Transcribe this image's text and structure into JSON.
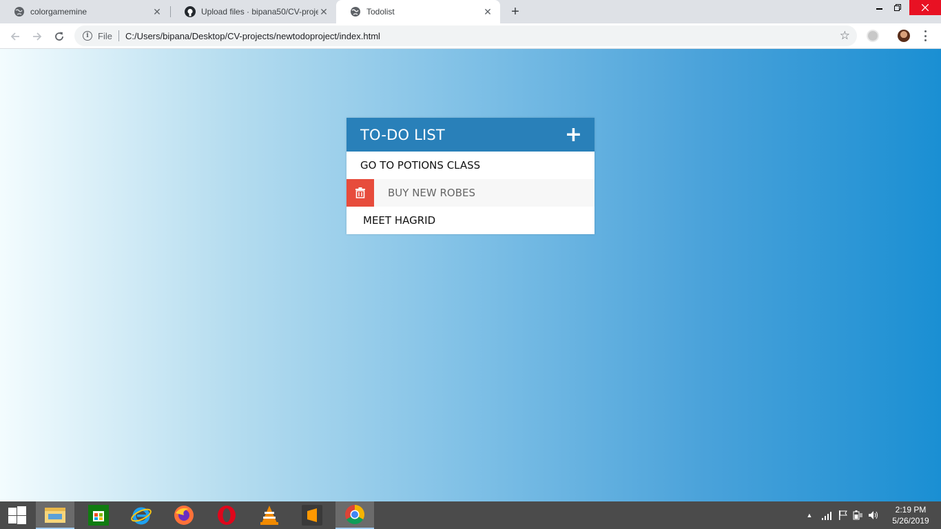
{
  "browser": {
    "tabs": [
      {
        "title": "colorgamemine",
        "icon": "globe-icon",
        "active": false
      },
      {
        "title": "Upload files · bipana50/CV-proje",
        "icon": "github-icon",
        "active": false
      },
      {
        "title": "Todolist",
        "icon": "globe-icon",
        "active": true
      }
    ],
    "new_tab_label": "+",
    "address": {
      "scheme_label": "File",
      "url": "C:/Users/bipana/Desktop/CV-projects/newtodoproject/index.html"
    }
  },
  "todo": {
    "title": "TO-DO LIST",
    "add_label": "+",
    "items": [
      {
        "text": "GO TO POTIONS CLASS"
      },
      {
        "text": "BUY NEW ROBES"
      },
      {
        "text": "MEET HAGRID"
      }
    ]
  },
  "taskbar": {
    "apps": [
      "file-explorer-icon",
      "store-icon",
      "internet-explorer-icon",
      "firefox-icon",
      "opera-icon",
      "vlc-icon",
      "sublime-text-icon",
      "chrome-icon"
    ],
    "clock_time": "2:19 PM",
    "clock_date": "5/26/2019"
  },
  "colors": {
    "header": "#2980b9",
    "delete": "#e74c3c",
    "gradient_start": "#f3fcfe",
    "gradient_end": "#1a8fd3"
  }
}
